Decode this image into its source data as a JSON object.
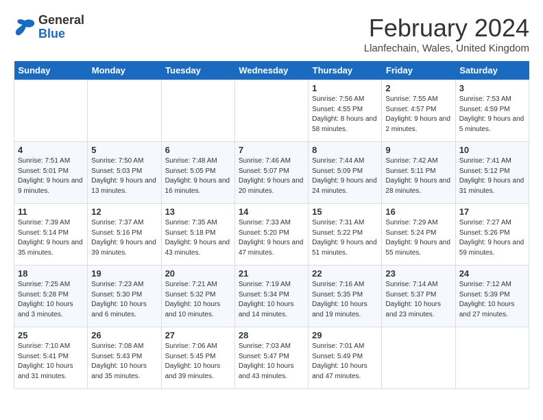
{
  "header": {
    "logo_general": "General",
    "logo_blue": "Blue",
    "month_title": "February 2024",
    "location": "Llanfechain, Wales, United Kingdom"
  },
  "days_of_week": [
    "Sunday",
    "Monday",
    "Tuesday",
    "Wednesday",
    "Thursday",
    "Friday",
    "Saturday"
  ],
  "weeks": [
    [
      {
        "day": "",
        "info": ""
      },
      {
        "day": "",
        "info": ""
      },
      {
        "day": "",
        "info": ""
      },
      {
        "day": "",
        "info": ""
      },
      {
        "day": "1",
        "info": "Sunrise: 7:56 AM\nSunset: 4:55 PM\nDaylight: 8 hours and 58 minutes."
      },
      {
        "day": "2",
        "info": "Sunrise: 7:55 AM\nSunset: 4:57 PM\nDaylight: 9 hours and 2 minutes."
      },
      {
        "day": "3",
        "info": "Sunrise: 7:53 AM\nSunset: 4:59 PM\nDaylight: 9 hours and 5 minutes."
      }
    ],
    [
      {
        "day": "4",
        "info": "Sunrise: 7:51 AM\nSunset: 5:01 PM\nDaylight: 9 hours and 9 minutes."
      },
      {
        "day": "5",
        "info": "Sunrise: 7:50 AM\nSunset: 5:03 PM\nDaylight: 9 hours and 13 minutes."
      },
      {
        "day": "6",
        "info": "Sunrise: 7:48 AM\nSunset: 5:05 PM\nDaylight: 9 hours and 16 minutes."
      },
      {
        "day": "7",
        "info": "Sunrise: 7:46 AM\nSunset: 5:07 PM\nDaylight: 9 hours and 20 minutes."
      },
      {
        "day": "8",
        "info": "Sunrise: 7:44 AM\nSunset: 5:09 PM\nDaylight: 9 hours and 24 minutes."
      },
      {
        "day": "9",
        "info": "Sunrise: 7:42 AM\nSunset: 5:11 PM\nDaylight: 9 hours and 28 minutes."
      },
      {
        "day": "10",
        "info": "Sunrise: 7:41 AM\nSunset: 5:12 PM\nDaylight: 9 hours and 31 minutes."
      }
    ],
    [
      {
        "day": "11",
        "info": "Sunrise: 7:39 AM\nSunset: 5:14 PM\nDaylight: 9 hours and 35 minutes."
      },
      {
        "day": "12",
        "info": "Sunrise: 7:37 AM\nSunset: 5:16 PM\nDaylight: 9 hours and 39 minutes."
      },
      {
        "day": "13",
        "info": "Sunrise: 7:35 AM\nSunset: 5:18 PM\nDaylight: 9 hours and 43 minutes."
      },
      {
        "day": "14",
        "info": "Sunrise: 7:33 AM\nSunset: 5:20 PM\nDaylight: 9 hours and 47 minutes."
      },
      {
        "day": "15",
        "info": "Sunrise: 7:31 AM\nSunset: 5:22 PM\nDaylight: 9 hours and 51 minutes."
      },
      {
        "day": "16",
        "info": "Sunrise: 7:29 AM\nSunset: 5:24 PM\nDaylight: 9 hours and 55 minutes."
      },
      {
        "day": "17",
        "info": "Sunrise: 7:27 AM\nSunset: 5:26 PM\nDaylight: 9 hours and 59 minutes."
      }
    ],
    [
      {
        "day": "18",
        "info": "Sunrise: 7:25 AM\nSunset: 5:28 PM\nDaylight: 10 hours and 3 minutes."
      },
      {
        "day": "19",
        "info": "Sunrise: 7:23 AM\nSunset: 5:30 PM\nDaylight: 10 hours and 6 minutes."
      },
      {
        "day": "20",
        "info": "Sunrise: 7:21 AM\nSunset: 5:32 PM\nDaylight: 10 hours and 10 minutes."
      },
      {
        "day": "21",
        "info": "Sunrise: 7:19 AM\nSunset: 5:34 PM\nDaylight: 10 hours and 14 minutes."
      },
      {
        "day": "22",
        "info": "Sunrise: 7:16 AM\nSunset: 5:35 PM\nDaylight: 10 hours and 19 minutes."
      },
      {
        "day": "23",
        "info": "Sunrise: 7:14 AM\nSunset: 5:37 PM\nDaylight: 10 hours and 23 minutes."
      },
      {
        "day": "24",
        "info": "Sunrise: 7:12 AM\nSunset: 5:39 PM\nDaylight: 10 hours and 27 minutes."
      }
    ],
    [
      {
        "day": "25",
        "info": "Sunrise: 7:10 AM\nSunset: 5:41 PM\nDaylight: 10 hours and 31 minutes."
      },
      {
        "day": "26",
        "info": "Sunrise: 7:08 AM\nSunset: 5:43 PM\nDaylight: 10 hours and 35 minutes."
      },
      {
        "day": "27",
        "info": "Sunrise: 7:06 AM\nSunset: 5:45 PM\nDaylight: 10 hours and 39 minutes."
      },
      {
        "day": "28",
        "info": "Sunrise: 7:03 AM\nSunset: 5:47 PM\nDaylight: 10 hours and 43 minutes."
      },
      {
        "day": "29",
        "info": "Sunrise: 7:01 AM\nSunset: 5:49 PM\nDaylight: 10 hours and 47 minutes."
      },
      {
        "day": "",
        "info": ""
      },
      {
        "day": "",
        "info": ""
      }
    ]
  ]
}
